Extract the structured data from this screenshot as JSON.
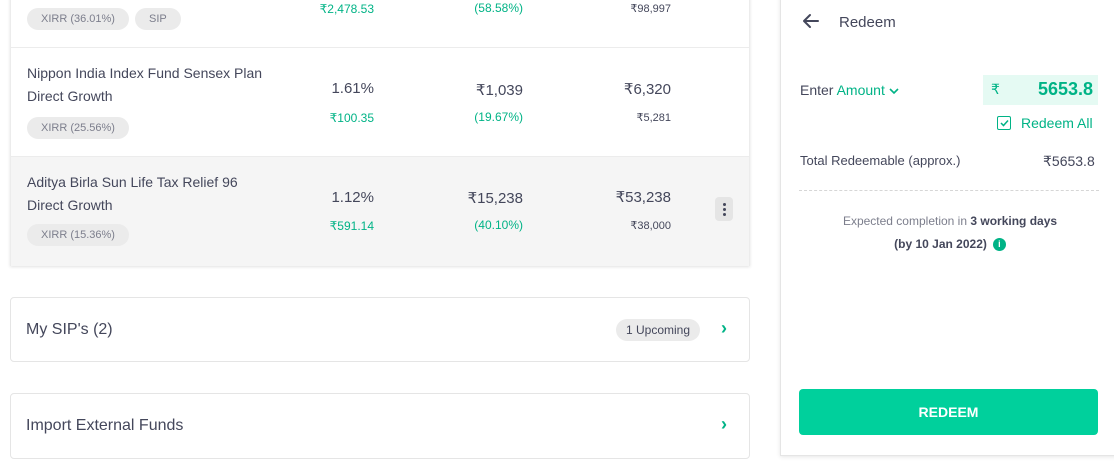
{
  "holdings": [
    {
      "name": "",
      "chips": [
        "XIRR (36.01%)",
        "SIP"
      ],
      "returns_pct": "",
      "returns_amt": "₹2,478.53",
      "current": "",
      "current_pct": "(58.58%)",
      "value": "",
      "invested": "₹98,997"
    },
    {
      "name": "Nippon India Index Fund Sensex Plan Direct Growth",
      "chips": [
        "XIRR (25.56%)"
      ],
      "returns_pct": "1.61%",
      "returns_amt": "₹100.35",
      "current": "₹1,039",
      "current_pct": "(19.67%)",
      "value": "₹6,320",
      "invested": "₹5,281"
    },
    {
      "name": "Aditya Birla Sun Life Tax Relief 96 Direct Growth",
      "chips": [
        "XIRR (15.36%)"
      ],
      "returns_pct": "1.12%",
      "returns_amt": "₹591.14",
      "current": "₹15,238",
      "current_pct": "(40.10%)",
      "value": "₹53,238",
      "invested": "₹38,000"
    }
  ],
  "sips": {
    "title": "My SIP's (2)",
    "badge": "1 Upcoming"
  },
  "import": {
    "title": "Import External Funds"
  },
  "redeem": {
    "title": "Redeem",
    "enter_label": "Enter",
    "amount_label": "Amount",
    "currency": "₹",
    "amount_value": "5653.8",
    "redeem_all": "Redeem All",
    "total_label": "Total Redeemable (approx.)",
    "total_value": "₹5653.8",
    "expected_prefix": "Expected completion in",
    "expected_days": "3 working days",
    "expected_date": "(by 10 Jan 2022)",
    "button": "REDEEM"
  },
  "colors": {
    "accent": "#00b386",
    "button": "#00d09c",
    "chip": "#ebebeb"
  }
}
